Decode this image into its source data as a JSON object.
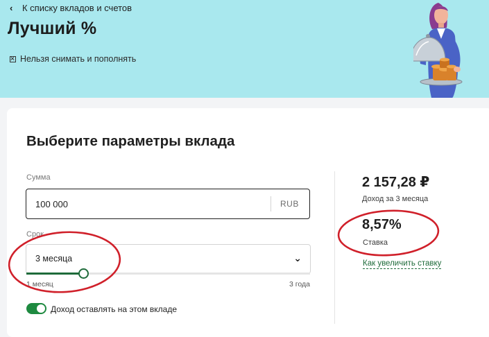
{
  "header": {
    "back_label": "К списку вкладов и счетов",
    "title": "Лучший %",
    "restriction_label": "Нельзя снимать и пополнять"
  },
  "card": {
    "title": "Выберите параметры вклада",
    "amount": {
      "label": "Сумма",
      "value": "100 000",
      "currency": "RUB"
    },
    "term": {
      "label": "Срок",
      "value": "3 месяца",
      "min_label": "1 месяц",
      "max_label": "3 года",
      "slider_fraction": 0.2
    },
    "reinvest": {
      "label": "Доход оставлять на этом вкладе",
      "enabled": true
    },
    "summary": {
      "income_amount": "2 157,28 ₽",
      "income_label": "Доход за 3 месяца",
      "rate_value": "8,57%",
      "rate_label": "Ставка",
      "increase_rate_link": "Как увеличить ставку"
    }
  },
  "icons": {
    "back": "chevron-left-icon",
    "restriction": "crossed-box-icon",
    "term_dropdown": "chevron-down-icon"
  },
  "colors": {
    "hero_background": "#a9e8ee",
    "accent_green": "#1e6b3a",
    "toggle_green": "#1e8a40",
    "annotation_red": "#d0202a"
  }
}
